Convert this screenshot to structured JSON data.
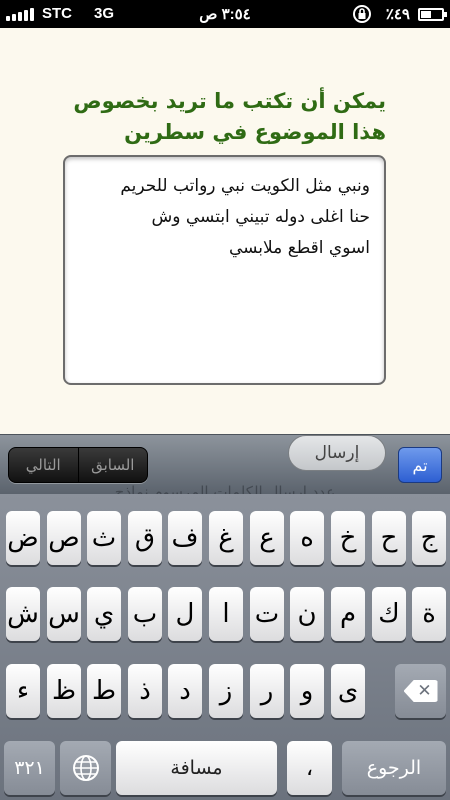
{
  "status_bar": {
    "carrier": "STC",
    "network": "3G",
    "time": "٣:٥٤ ص",
    "battery_percent": "٪٤٩",
    "battery_level": 0.49
  },
  "form": {
    "heading": "يمكن أن تكتب ما تريد بخصوص هذا الموضوع في سطرين",
    "message_lines": [
      "ونبي مثل الكويت نبي رواتب للحريم",
      "حنا اغلى دوله تبيني ابتسي وش",
      "اسوي اقطع ملابسي"
    ]
  },
  "toolbar": {
    "next_label": "التالي",
    "previous_label": "السابق",
    "send_label": "إرسال",
    "done_label": "تم",
    "partial_text": "عدد إرسال الكلمات المرسوم نماذج"
  },
  "keyboard": {
    "row1": [
      "ج",
      "ح",
      "خ",
      "ه",
      "ع",
      "غ",
      "ف",
      "ق",
      "ث",
      "ص",
      "ض"
    ],
    "row2": [
      "ة",
      "ك",
      "م",
      "ن",
      "ت",
      "ا",
      "ل",
      "ب",
      "ي",
      "س",
      "ش"
    ],
    "row3": [
      "ى",
      "و",
      "ر",
      "ز",
      "د",
      "ذ",
      "ط",
      "ظ",
      "ء"
    ],
    "numbers_label": "٣٢١",
    "space_label": "مسافة",
    "punct_label": "،",
    "return_label": "الرجوع",
    "icons": {
      "delete": "delete-icon",
      "globe": "globe-icon",
      "lock": "orientation-lock-icon"
    }
  }
}
